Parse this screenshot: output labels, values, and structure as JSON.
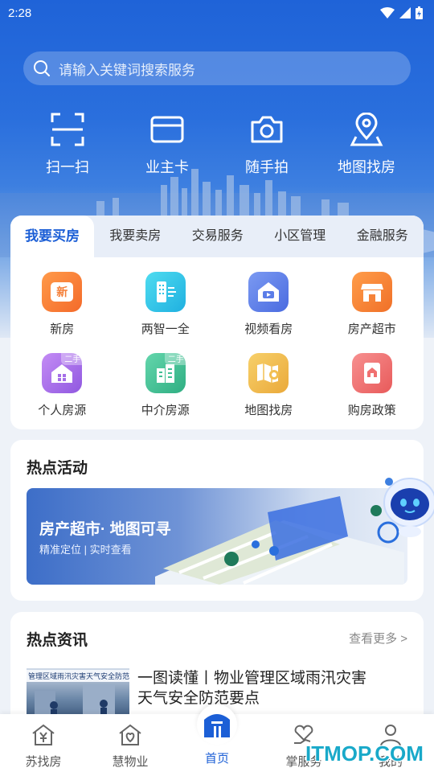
{
  "status": {
    "time": "2:28"
  },
  "search": {
    "placeholder": "请输入关键词搜索服务"
  },
  "quick_actions": [
    {
      "label": "扫一扫",
      "icon": "scan-icon"
    },
    {
      "label": "业主卡",
      "icon": "card-icon"
    },
    {
      "label": "随手拍",
      "icon": "camera-icon"
    },
    {
      "label": "地图找房",
      "icon": "map-pin-icon"
    }
  ],
  "service_tabs": [
    "我要买房",
    "我要卖房",
    "交易服务",
    "小区管理",
    "金融服务"
  ],
  "services": [
    {
      "label": "新房",
      "icon": "new-house-icon",
      "color": "#f5803a",
      "glyph": "新"
    },
    {
      "label": "两智一全",
      "icon": "smart-building-icon",
      "color": "#2bc4e6"
    },
    {
      "label": "视频看房",
      "icon": "video-house-icon",
      "color": "#5b7de8"
    },
    {
      "label": "房产超市",
      "icon": "store-icon",
      "color": "#f5833a"
    },
    {
      "label": "个人房源",
      "icon": "personal-house-icon",
      "color": "#a56ee8",
      "badge": "二手"
    },
    {
      "label": "中介房源",
      "icon": "agency-house-icon",
      "color": "#3fbf94",
      "badge": "二手"
    },
    {
      "label": "地图找房",
      "icon": "map-house-icon",
      "color": "#f2bf52"
    },
    {
      "label": "购房政策",
      "icon": "policy-icon",
      "color": "#f07070"
    }
  ],
  "activity": {
    "title": "热点活动",
    "banner_title": "房产超市· 地图可寻",
    "banner_sub": "精准定位 | 实时查看"
  },
  "news": {
    "title": "热点资讯",
    "more": "查看更多 >",
    "items": [
      {
        "title": "一图读懂丨物业管理区域雨汛灾害天气安全防范要点",
        "thumb_text": "管理区域雨汛灾害天气安全防范"
      }
    ]
  },
  "bottom_nav": [
    {
      "label": "苏找房",
      "icon": "house-yen-icon"
    },
    {
      "label": "慧物业",
      "icon": "house-heart-icon"
    },
    {
      "label": "首页",
      "icon": "home-icon",
      "active": true
    },
    {
      "label": "掌服务",
      "icon": "hand-heart-icon"
    },
    {
      "label": "我的",
      "icon": "user-icon"
    }
  ],
  "watermark": "ITMOP.COM",
  "colors": {
    "primary": "#1c5fd6",
    "hero_top": "#1f63d8"
  }
}
